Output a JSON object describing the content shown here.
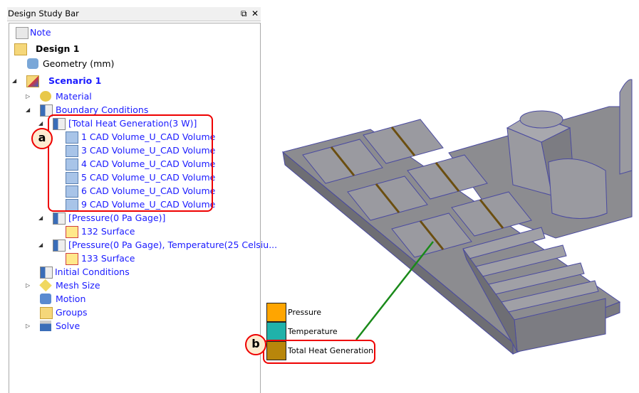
{
  "panel": {
    "title": "Design Study Bar",
    "float_icon": "⧉",
    "close_icon": "✕"
  },
  "tree": [
    {
      "label": "Note",
      "icon": "note-icon"
    },
    {
      "label": "Design 1",
      "icon": "design-folder-icon"
    },
    {
      "label": "Geometry (mm)",
      "icon": "geometry-icon"
    },
    {
      "label": "Scenario 1",
      "icon": "scenario-folder-icon"
    },
    {
      "label": "Material",
      "icon": "material-icon"
    },
    {
      "label": "Boundary Conditions",
      "icon": "boundary-icon"
    },
    {
      "label": "[Total Heat Generation(3 W)]",
      "icon": "boundary-icon"
    },
    {
      "label": "1 CAD Volume_U_CAD Volume",
      "icon": "volume-icon"
    },
    {
      "label": "3 CAD Volume_U_CAD Volume",
      "icon": "volume-icon"
    },
    {
      "label": "4 CAD Volume_U_CAD Volume",
      "icon": "volume-icon"
    },
    {
      "label": "5 CAD Volume_U_CAD Volume",
      "icon": "volume-icon"
    },
    {
      "label": "6 CAD Volume_U_CAD Volume",
      "icon": "volume-icon"
    },
    {
      "label": "9 CAD Volume_U_CAD Volume",
      "icon": "volume-icon"
    },
    {
      "label": "[Pressure(0 Pa Gage)]",
      "icon": "boundary-icon"
    },
    {
      "label": "132 Surface",
      "icon": "surface-icon"
    },
    {
      "label": "[Pressure(0 Pa Gage), Temperature(25 Celsiu...",
      "icon": "boundary-icon"
    },
    {
      "label": "133 Surface",
      "icon": "surface-icon"
    },
    {
      "label": "Initial Conditions",
      "icon": "boundary-icon"
    },
    {
      "label": "Mesh Size",
      "icon": "mesh-icon"
    },
    {
      "label": "Motion",
      "icon": "motion-icon"
    },
    {
      "label": "Groups",
      "icon": "groups-icon"
    },
    {
      "label": "Solve",
      "icon": "solve-icon"
    }
  ],
  "callouts": {
    "a": "a",
    "b": "b"
  },
  "legend": [
    {
      "label": "Pressure",
      "color": "#ffa500"
    },
    {
      "label": "Temperature",
      "color": "#20b2aa"
    },
    {
      "label": "Total Heat Generation",
      "color": "#b8860b"
    }
  ],
  "colors": {
    "callout": "#ee0000",
    "leader": "#1a8a1a",
    "model": "#8c8c90",
    "edge": "#4a4aa0"
  }
}
